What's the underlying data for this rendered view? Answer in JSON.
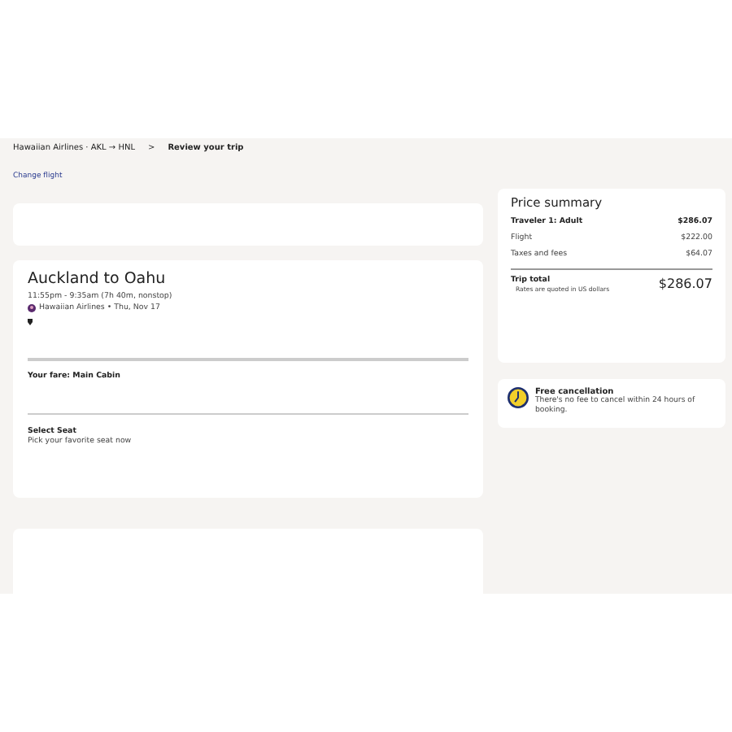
{
  "breadcrumb": {
    "parent": "Hawaiian Airlines · AKL → HNL",
    "separator": ">",
    "current": "Review your trip",
    "link": "Change flight"
  },
  "flight": {
    "title": "Auckland to Oahu",
    "times": "11:55pm - 9:35am (7h 40m, nonstop)",
    "carrier": "Hawaiian Airlines • Thu, Nov 17"
  },
  "fare": {
    "label": "Your fare: Main Cabin"
  },
  "seat": {
    "title": "Select Seat",
    "subtitle": "Pick your favorite seat now"
  },
  "price_summary": {
    "title": "Price summary",
    "lines": [
      {
        "label": "Traveler 1: Adult",
        "amount": "$286.07",
        "kind": "bold"
      },
      {
        "label": "Flight",
        "amount": "$222.00",
        "kind": "plain"
      },
      {
        "label": "Taxes and fees",
        "amount": "$64.07",
        "kind": "plain"
      }
    ],
    "total_label": "Trip total",
    "total_note": "Rates are quoted in US dollars",
    "total": "$286.07"
  },
  "cancellation": {
    "title": "Free cancellation",
    "text": "There's no fee to cancel within 24 hours of booking."
  }
}
